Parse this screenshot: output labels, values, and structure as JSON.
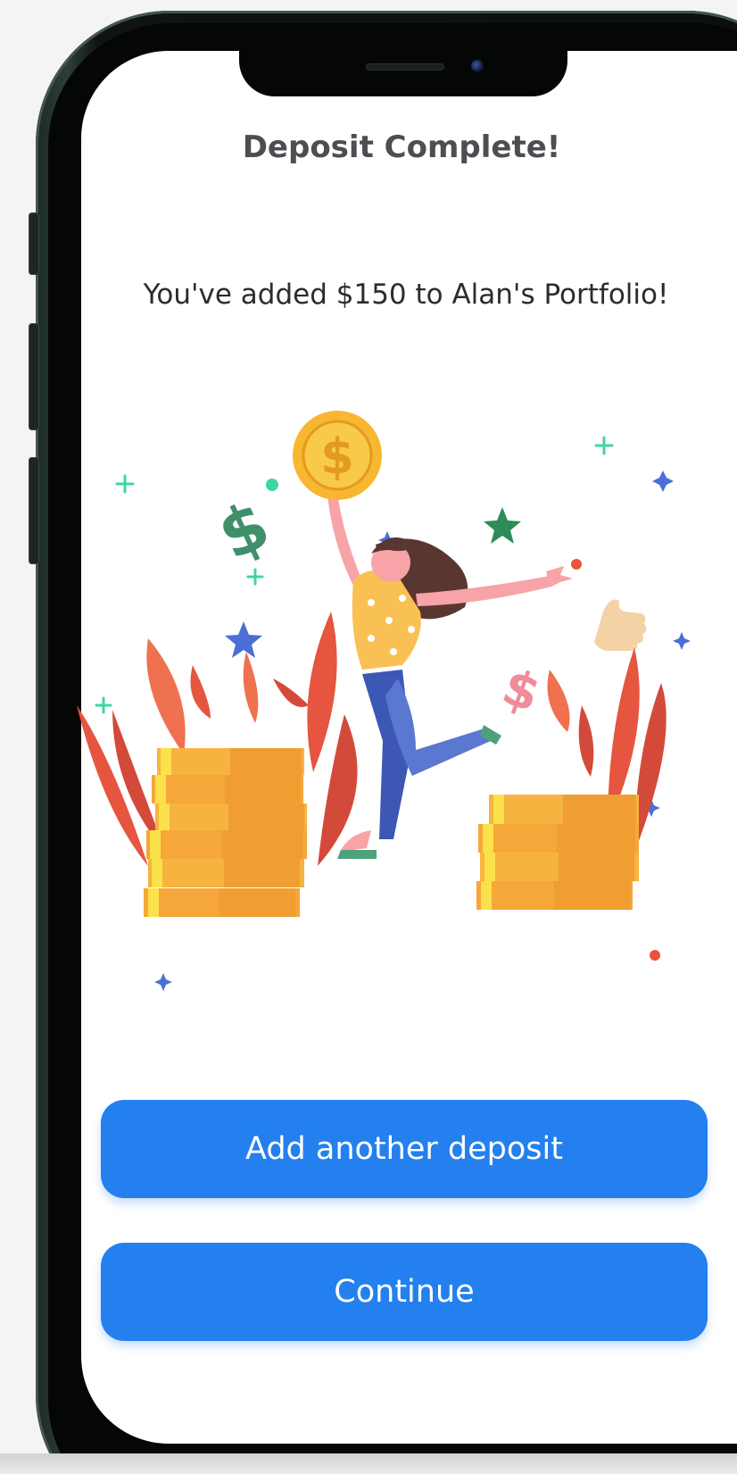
{
  "screen": {
    "title": "Deposit Complete!",
    "message": "You've added $150 to Alan's Portfolio!"
  },
  "actions": {
    "add_deposit_label": "Add another deposit",
    "continue_label": "Continue"
  },
  "illustration": {
    "coin_symbol": "$",
    "dollar_sign": "$"
  },
  "colors": {
    "primary_button": "#2380ee",
    "title_text": "#4d4d52",
    "coin_gold": "#f7b731"
  }
}
